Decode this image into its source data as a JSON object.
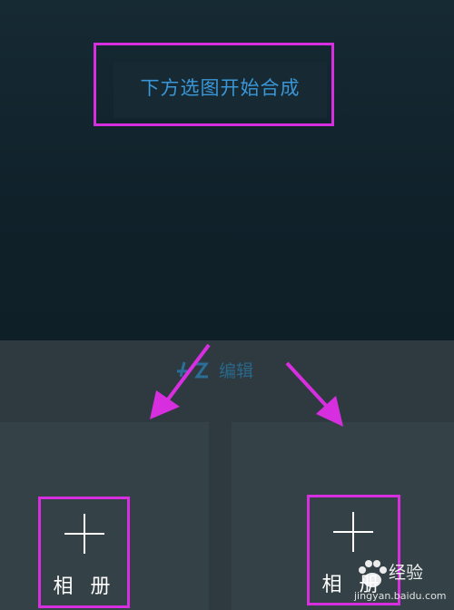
{
  "hint": {
    "text": "下方选图开始合成"
  },
  "edit": {
    "label": "编辑",
    "icon": "edit-icon"
  },
  "albums": [
    {
      "label": "相 册",
      "icon": "plus-icon"
    },
    {
      "label": "相 册",
      "icon": "plus-icon"
    }
  ],
  "watermark": {
    "brand": "经验",
    "url": "jingyan.baidu.com",
    "icon": "baidu-paw-icon"
  },
  "colors": {
    "highlight": "#d72ee0",
    "hint_text": "#3a96d6",
    "top_bg": "#12222a",
    "bottom_bg": "#2e3a3f",
    "panel_bg": "#344146"
  }
}
